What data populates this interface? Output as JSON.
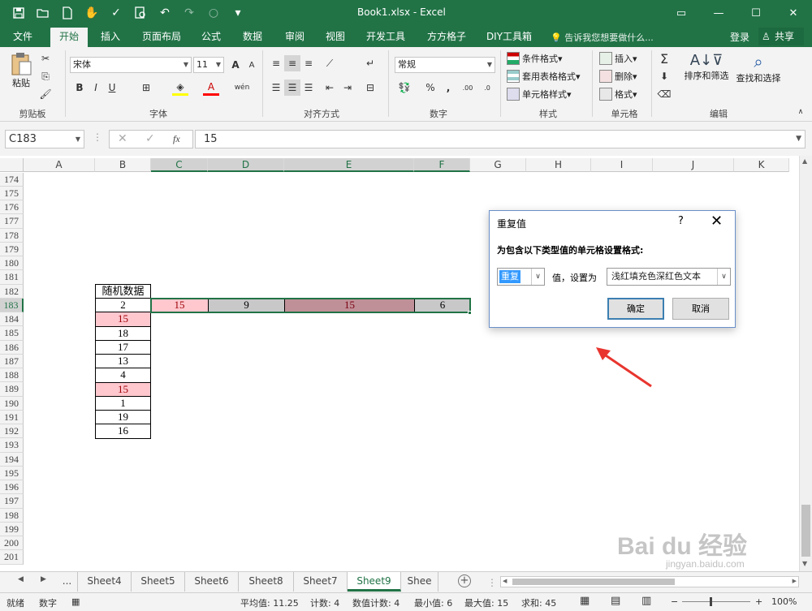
{
  "window": {
    "title": "Book1.xlsx - Excel",
    "controls": [
      "▭",
      "—",
      "☐",
      "✕"
    ]
  },
  "ribbon_tabs": [
    "文件",
    "开始",
    "插入",
    "页面布局",
    "公式",
    "数据",
    "审阅",
    "视图",
    "开发工具",
    "方方格子",
    "DIY工具箱"
  ],
  "tell_me": "告诉我您想要做什么...",
  "login": "登录",
  "share": "共享",
  "clipboard": {
    "paste": "粘贴",
    "label": "剪贴板"
  },
  "font": {
    "name": "宋体",
    "size": "11",
    "label": "字体",
    "bold": "B",
    "italic": "I",
    "underline": "U",
    "grow": "A",
    "shrink": "A",
    "wen": "wén"
  },
  "alignment": {
    "label": "对齐方式"
  },
  "number": {
    "format": "常规",
    "label": "数字",
    "percent": "%",
    "comma": ","
  },
  "styles": {
    "cond": "条件格式",
    "table": "套用表格格式",
    "cell": "单元格样式",
    "label": "样式"
  },
  "cells": {
    "insert": "插入",
    "delete": "删除",
    "format": "格式",
    "label": "单元格"
  },
  "editing": {
    "sort": "排序和筛选",
    "find": "查找和选择",
    "label": "编辑",
    "sigma": "Σ"
  },
  "formula_bar": {
    "name_box": "C183",
    "fx": "fx",
    "value": "15"
  },
  "columns": [
    "A",
    "B",
    "C",
    "D",
    "E",
    "F",
    "G",
    "H",
    "I",
    "J",
    "K"
  ],
  "rows": [
    "174",
    "175",
    "176",
    "177",
    "178",
    "179",
    "180",
    "181",
    "182",
    "183",
    "184",
    "185",
    "186",
    "187",
    "188",
    "189",
    "190",
    "191",
    "192",
    "193",
    "194",
    "195",
    "196",
    "197",
    "198",
    "199",
    "200",
    "201"
  ],
  "b_column": {
    "header": "随机数据",
    "values": [
      "2",
      "15",
      "18",
      "17",
      "13",
      "4",
      "15",
      "1",
      "19",
      "16"
    ],
    "highlight": [
      false,
      true,
      false,
      false,
      false,
      false,
      true,
      false,
      false,
      false
    ]
  },
  "row183": {
    "c": "15",
    "d": "9",
    "e": "15",
    "f": "6"
  },
  "colors": {
    "excel_green": "#217346",
    "dup_fill": "#ffc7ce",
    "dup_text": "#9c0006",
    "select_gray": "#c8c8c8"
  },
  "dialog": {
    "title": "重复值",
    "help": "?",
    "close": "✕",
    "description": "为包含以下类型值的单元格设置格式:",
    "type_value": "重复",
    "mid_text": "值，设置为",
    "format_value": "浅红填充色深红色文本",
    "ok": "确定",
    "cancel": "取消"
  },
  "sheets": [
    "...",
    "Sheet4",
    "Sheet5",
    "Sheet6",
    "Sheet8",
    "Sheet7",
    "Sheet9",
    "Shee"
  ],
  "status": {
    "ready": "就绪",
    "mode": "数字",
    "average": "平均值: 11.25",
    "count": "计数: 4",
    "numcount": "数值计数: 4",
    "min": "最小值: 6",
    "max": "最大值: 15",
    "sum": "求和: 45",
    "zoom": "100%"
  },
  "watermark": {
    "main": "Bai du 经验",
    "url": "jingyan.baidu.com"
  }
}
